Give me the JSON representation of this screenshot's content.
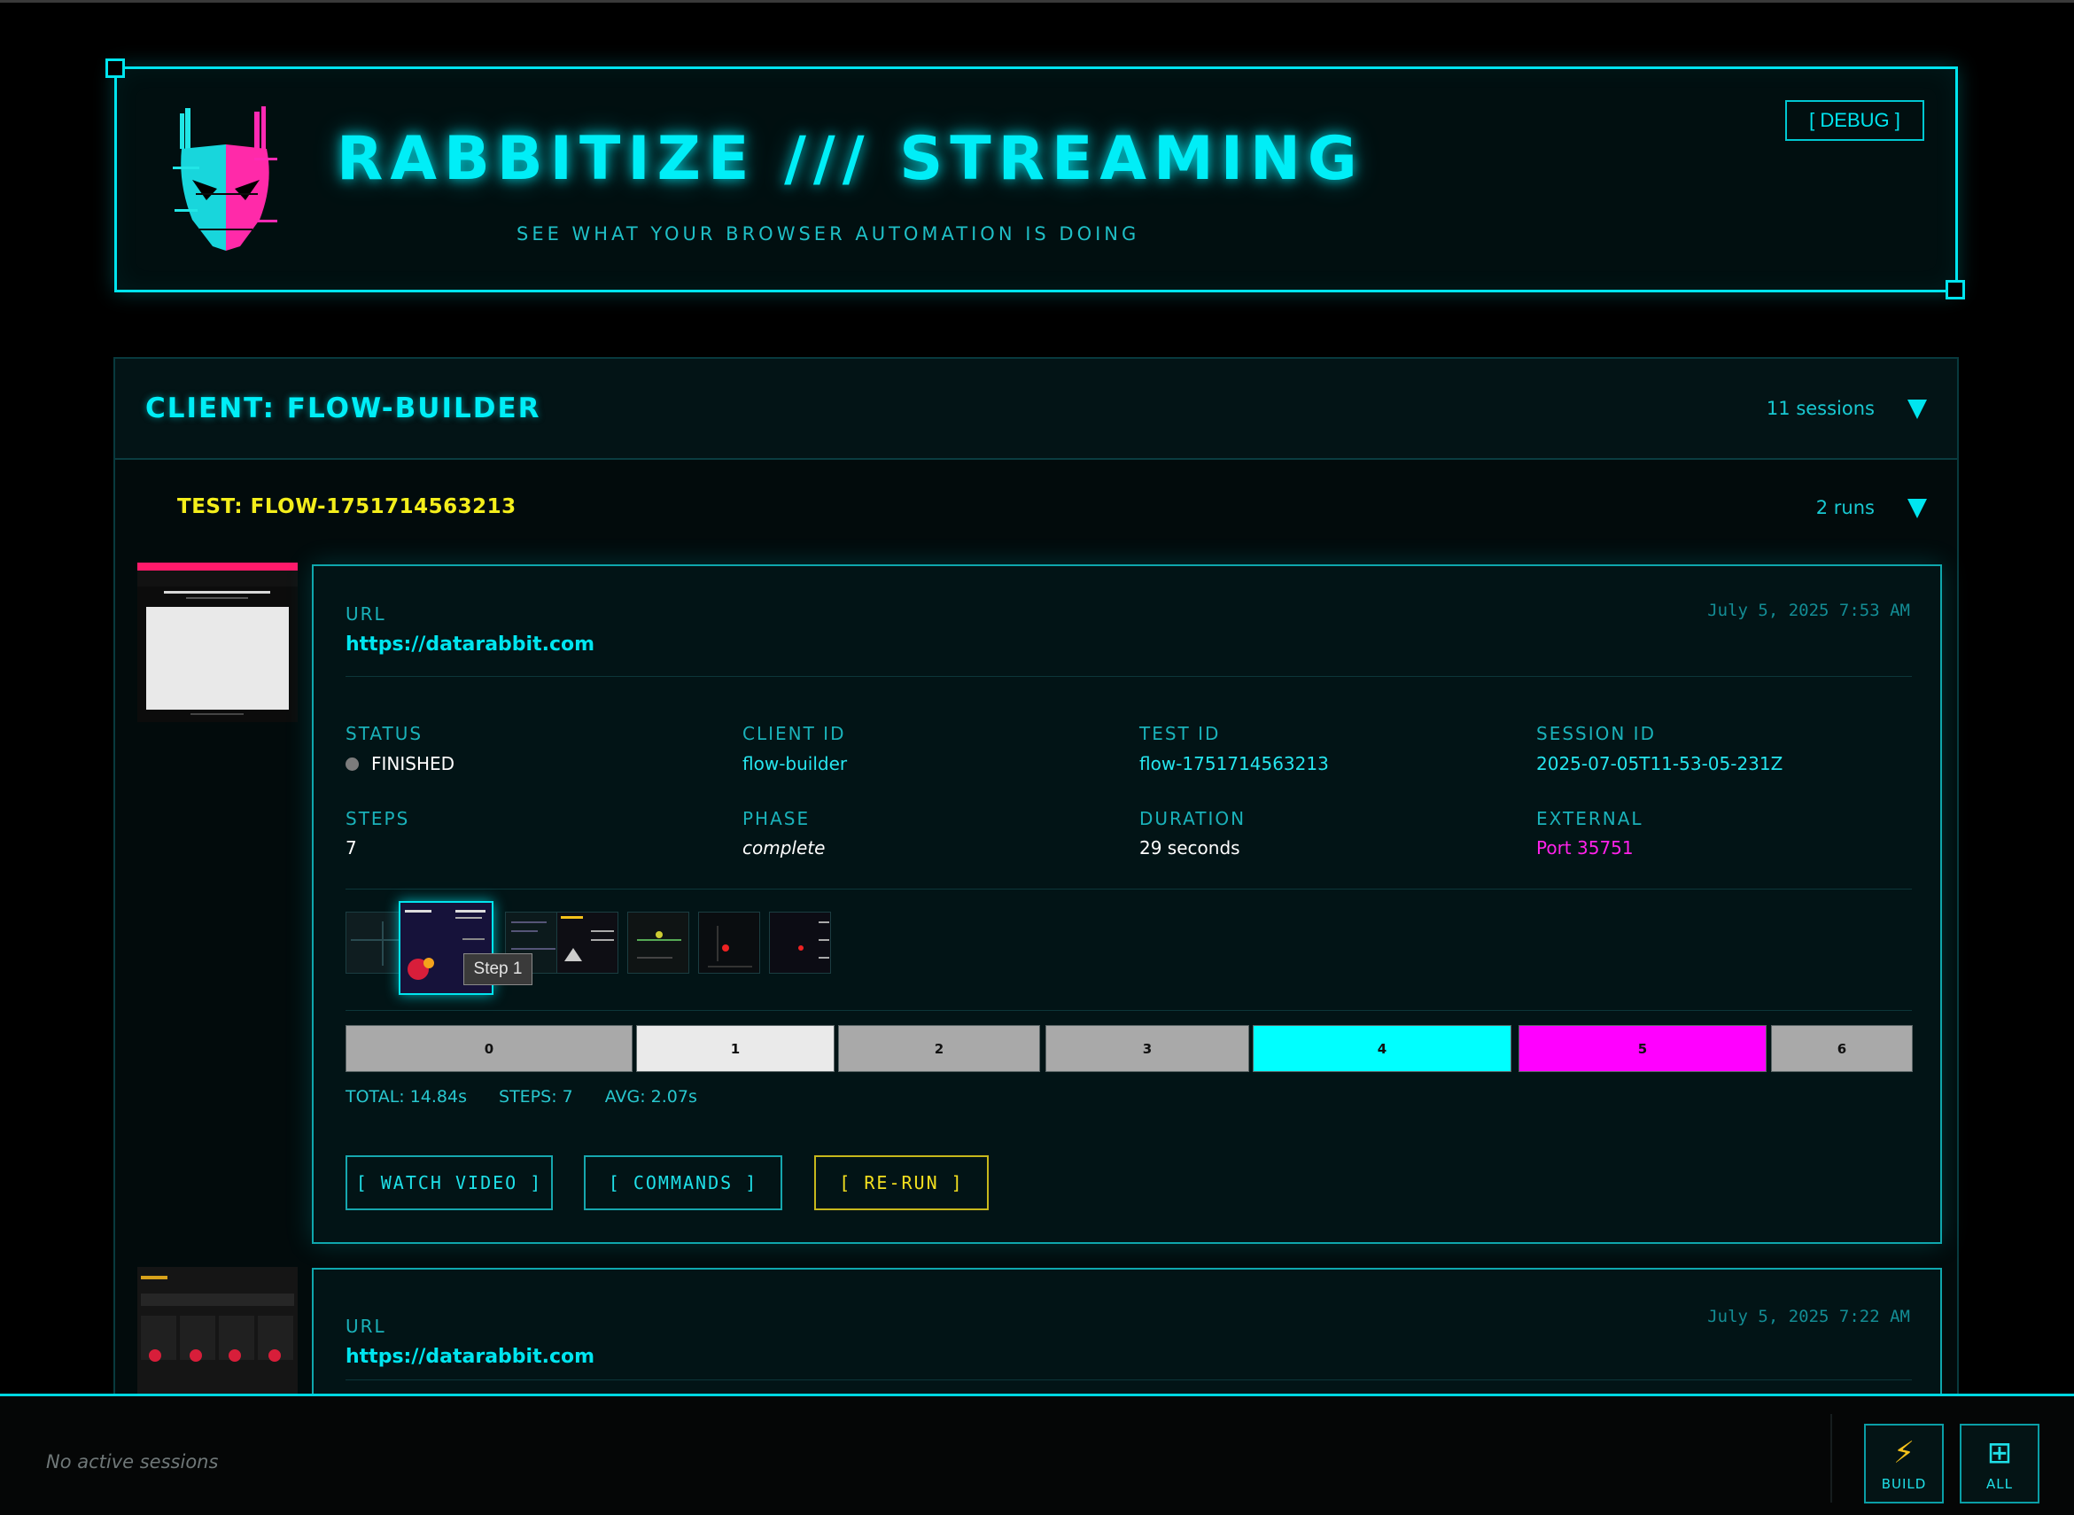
{
  "header": {
    "title": "RABBITIZE /// STREAMING",
    "subtitle": "SEE WHAT YOUR BROWSER AUTOMATION IS DOING",
    "debug_label": "[ DEBUG ]",
    "logo_icon": "rabbit-mask-logo"
  },
  "client": {
    "title": "CLIENT: FLOW-BUILDER",
    "sessions": "11 sessions"
  },
  "test": {
    "title": "TEST: FLOW-1751714563213",
    "runs": "2 runs"
  },
  "runs": [
    {
      "url_label": "URL",
      "url": "https://datarabbit.com",
      "timestamp": "July 5, 2025 7:53 AM",
      "fields": {
        "status_label": "STATUS",
        "status": "FINISHED",
        "client_id_label": "CLIENT ID",
        "client_id": "flow-builder",
        "test_id_label": "TEST ID",
        "test_id": "flow-1751714563213",
        "session_id_label": "SESSION ID",
        "session_id": "2025-07-05T11-53-05-231Z",
        "steps_label": "STEPS",
        "steps": "7",
        "phase_label": "PHASE",
        "phase": "complete",
        "duration_label": "DURATION",
        "duration": "29 seconds",
        "external_label": "EXTERNAL",
        "external": "Port 35751"
      },
      "tooltip": "Step 1",
      "timeline": [
        {
          "label": "0",
          "color": "#a9a9a9"
        },
        {
          "label": "1",
          "color": "#eaeaea"
        },
        {
          "label": "2",
          "color": "#a9a9a9"
        },
        {
          "label": "3",
          "color": "#a9a9a9"
        },
        {
          "label": "4",
          "color": "#00ffff"
        },
        {
          "label": "5",
          "color": "#ff00ff"
        },
        {
          "label": "6",
          "color": "#a9a9a9"
        }
      ],
      "stats": {
        "total": "TOTAL: 14.84s",
        "steps": "STEPS: 7",
        "avg": "AVG: 2.07s"
      },
      "buttons": {
        "watch": "[ WATCH VIDEO ]",
        "commands": "[ COMMANDS ]",
        "rerun": "[ RE-RUN ]"
      }
    },
    {
      "url_label": "URL",
      "url": "https://datarabbit.com",
      "timestamp": "July 5, 2025 7:22 AM"
    }
  ],
  "footer": {
    "status": "No active sessions",
    "build_label": "BUILD",
    "build_icon": "lightning-icon",
    "all_label": "ALL",
    "all_icon": "grid-icon"
  },
  "colors": {
    "accent": "#00e5ef",
    "magenta": "#ff00ff",
    "yellow": "#f4ee1b",
    "background": "#000000"
  }
}
